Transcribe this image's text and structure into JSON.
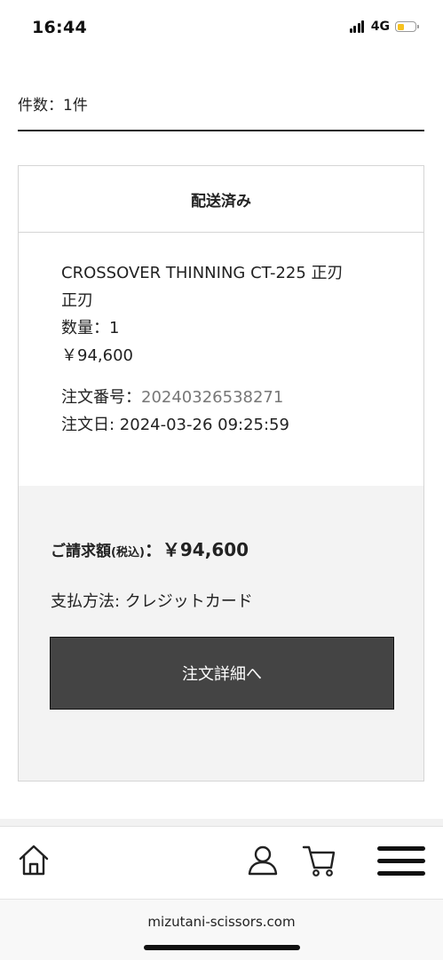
{
  "status": {
    "time": "16:44",
    "network": "4G",
    "battery_color": "#f7c21f"
  },
  "order_list": {
    "count_label": "件数：1件",
    "orders": [
      {
        "status": "配送済み",
        "product_name": "CROSSOVER THINNING CT-225 正刃",
        "variant": "正刃",
        "quantity": "数量：1",
        "price": "￥94,600",
        "order_number_label": "注文番号：",
        "order_number": "20240326538271",
        "order_date": "注文日: 2024-03-26 09:25:59",
        "total_label": "ご請求額",
        "tax_label": "(税込)",
        "total_value": "：￥94,600",
        "payment_method": "支払方法: クレジットカード",
        "detail_button": "注文詳細へ"
      }
    ]
  },
  "nav": {
    "icons": [
      "home-icon",
      "user-icon",
      "cart-icon",
      "menu-icon"
    ]
  },
  "browser": {
    "url": "mizutani-scissors.com"
  },
  "colors": {
    "button_bg": "#444444",
    "summary_bg": "#f3f3f3",
    "border": "#d5d5d5"
  }
}
